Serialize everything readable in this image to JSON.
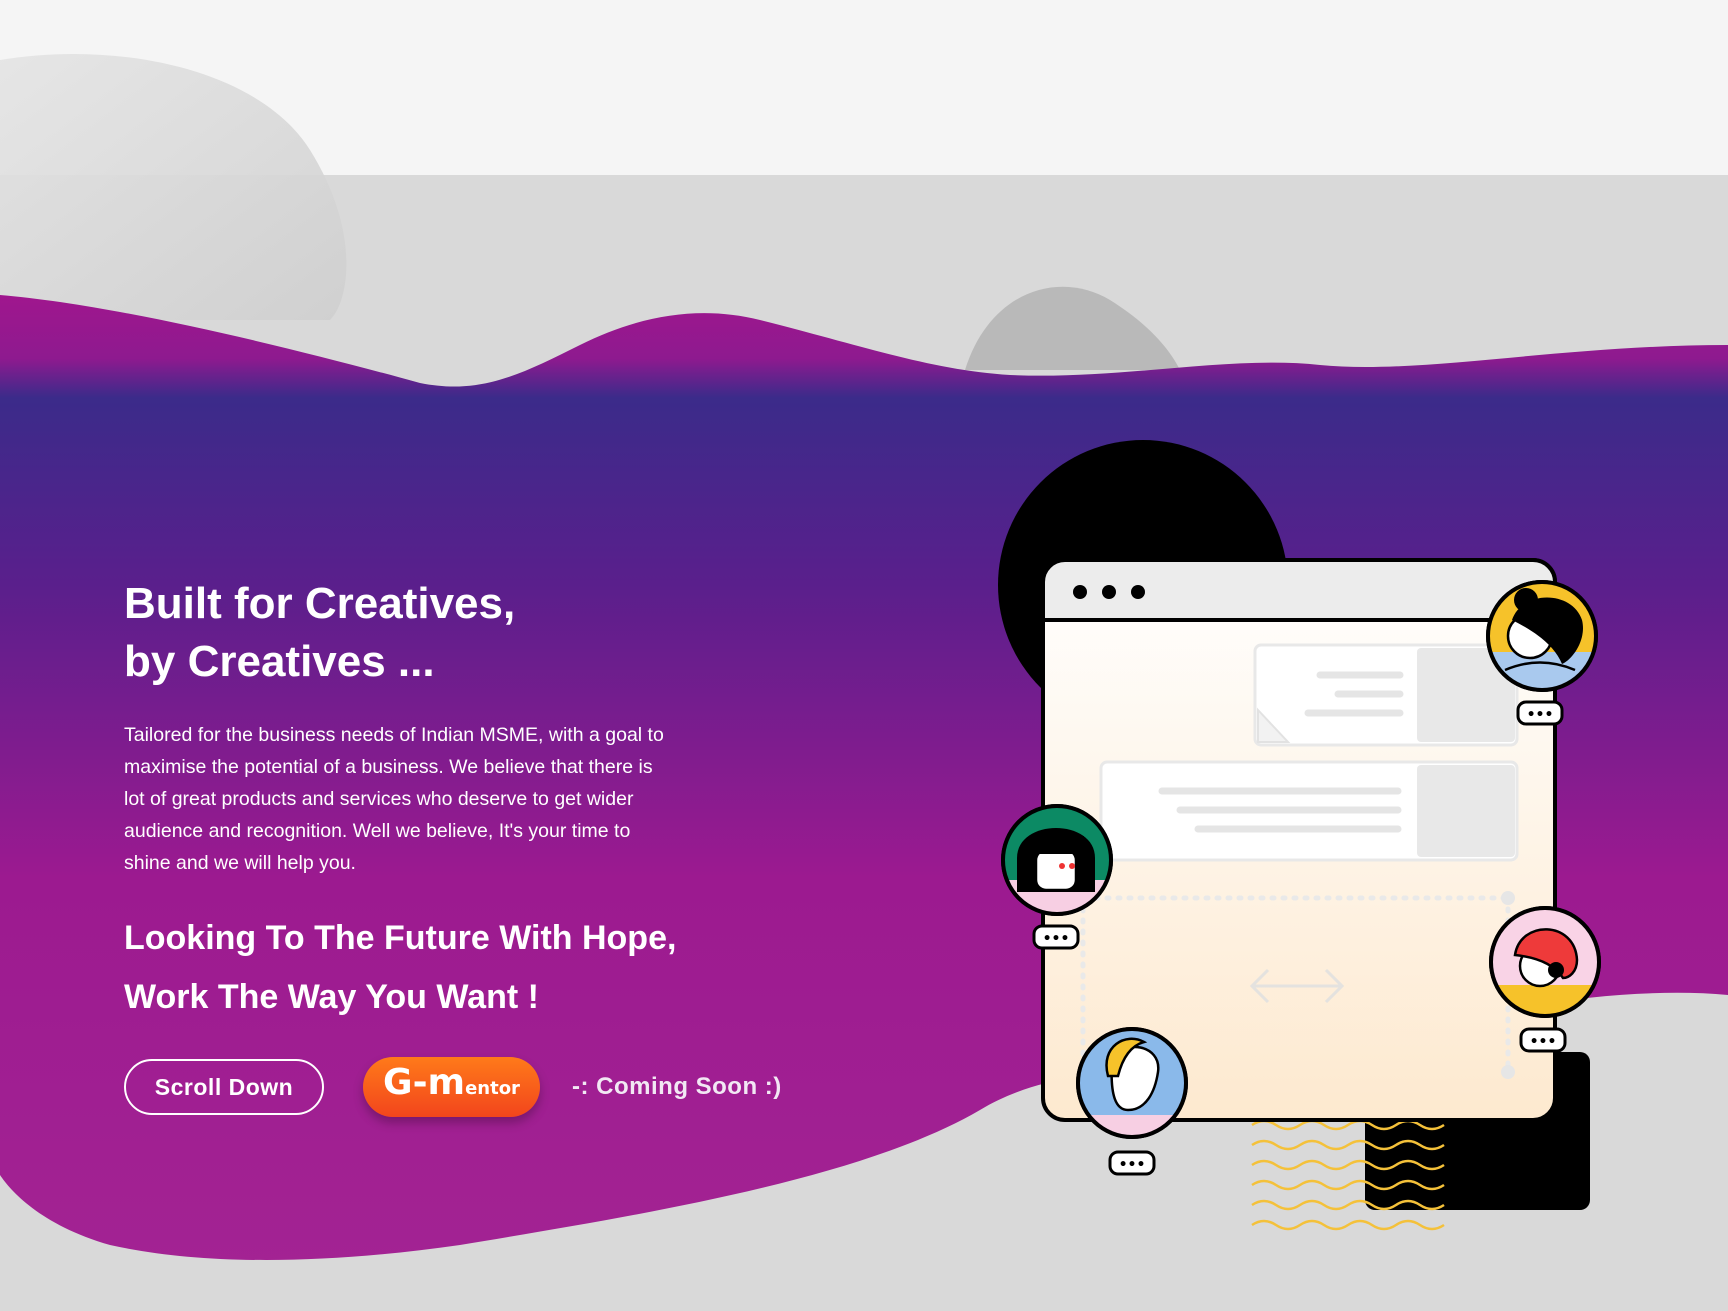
{
  "hero": {
    "headline_line1": "Built for Creatives,",
    "headline_line2": "by Creatives ...",
    "body": "Tailored for the business needs of Indian MSME, with a goal to maximise the potential of a business. We believe that there is lot of great products and services who deserve to get wider audience and recognition. Well we believe, It's your time to shine and we will help you.",
    "tagline_line1": "Looking To The Future With Hope,",
    "tagline_line2": "Work The Way You Want !"
  },
  "cta": {
    "scroll_label": "Scroll Down",
    "gmentor_main": "G-m",
    "gmentor_sub": "entor",
    "coming_soon": "-: Coming Soon :)"
  },
  "illustration": {
    "chat_bubble_text": "•••"
  },
  "colors": {
    "background": "#f5f5f5",
    "band_gray": "#d9d9d9",
    "gradient_top": "#a1168e",
    "gradient_indigo": "#3b2b8a",
    "gradient_bottom": "#a32393",
    "button_orange": "#f96a1b",
    "accent_yellow": "#f6c22a"
  }
}
